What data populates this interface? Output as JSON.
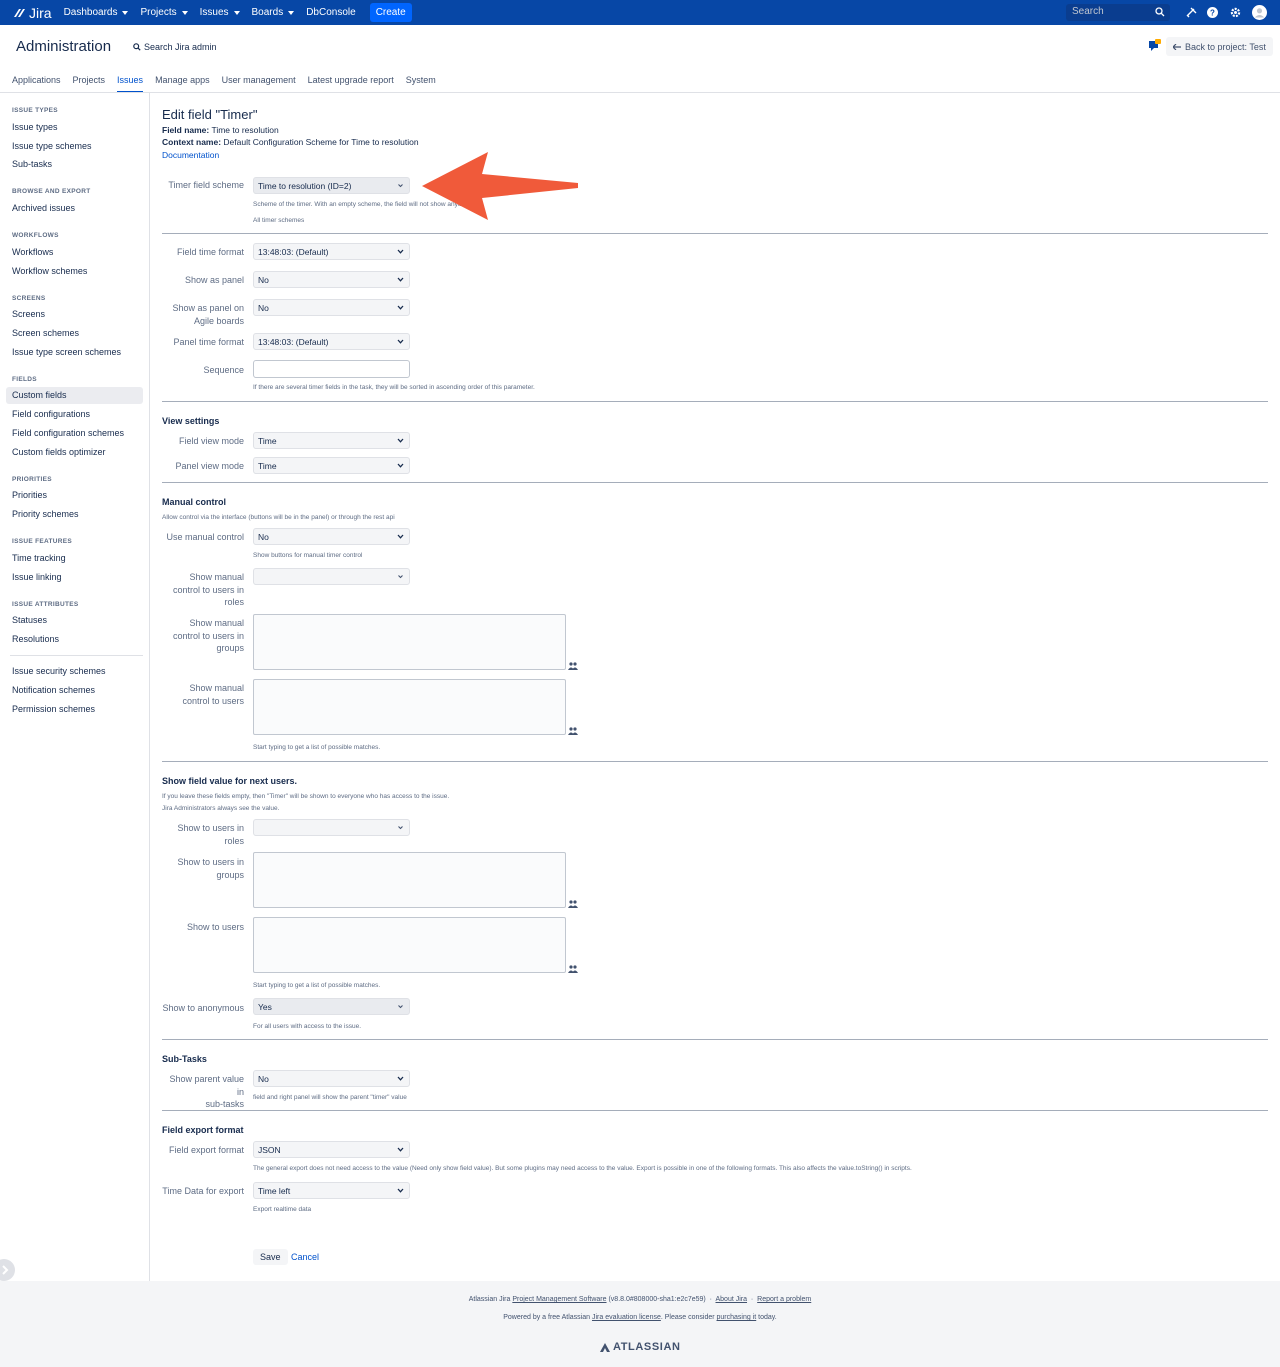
{
  "topnav": {
    "logo": "Jira",
    "items": [
      "Dashboards",
      "Projects",
      "Issues",
      "Boards",
      "DbConsole"
    ],
    "create": "Create",
    "search_placeholder": "Search"
  },
  "header": {
    "title": "Administration",
    "search": "Search Jira admin",
    "back": "Back to project: Test",
    "tabs": [
      "Applications",
      "Projects",
      "Issues",
      "Manage apps",
      "User management",
      "Latest upgrade report",
      "System"
    ],
    "active_tab": "Issues"
  },
  "sidebar": {
    "groups": [
      {
        "title": "ISSUE TYPES",
        "items": [
          "Issue types",
          "Issue type schemes",
          "Sub-tasks"
        ]
      },
      {
        "title": "BROWSE AND EXPORT",
        "items": [
          "Archived issues"
        ]
      },
      {
        "title": "WORKFLOWS",
        "items": [
          "Workflows",
          "Workflow schemes"
        ]
      },
      {
        "title": "SCREENS",
        "items": [
          "Screens",
          "Screen schemes",
          "Issue type screen schemes"
        ]
      },
      {
        "title": "FIELDS",
        "items": [
          "Custom fields",
          "Field configurations",
          "Field configuration schemes",
          "Custom fields optimizer"
        ]
      },
      {
        "title": "PRIORITIES",
        "items": [
          "Priorities",
          "Priority schemes"
        ]
      },
      {
        "title": "ISSUE FEATURES",
        "items": [
          "Time tracking",
          "Issue linking"
        ]
      },
      {
        "title": "ISSUE ATTRIBUTES",
        "items": [
          "Statuses",
          "Resolutions"
        ]
      }
    ],
    "extra": [
      "Issue security schemes",
      "Notification schemes",
      "Permission schemes"
    ],
    "active": "Custom fields"
  },
  "form": {
    "title": "Edit field \"Timer\"",
    "field_name_label": "Field name:",
    "field_name": "Time to resolution",
    "context_label": "Context name:",
    "context": "Default Configuration Scheme for Time to resolution",
    "documentation": "Documentation",
    "timer_scheme_label": "Timer field scheme",
    "timer_scheme_value": "Time to resolution (ID=2)",
    "timer_scheme_help": "Scheme of the timer. With an empty scheme, the field will not show anything.",
    "all_timer_schemes": "All timer schemes",
    "field_time_format_label": "Field time format",
    "field_time_format_value": "13:48:03: (Default)",
    "show_as_panel_label": "Show as panel",
    "show_as_panel_value": "No",
    "show_panel_agile_label_1": "Show as panel on",
    "show_panel_agile_label_2": "Agile boards",
    "show_panel_agile_value": "No",
    "panel_time_format_label": "Panel time format",
    "panel_time_format_value": "13:48:03: (Default)",
    "sequence_label": "Sequence",
    "sequence_help": "If there are several timer fields in the task, they will be sorted in ascending order of this parameter.",
    "view_settings": "View settings",
    "field_view_mode_label": "Field view mode",
    "field_view_mode_value": "Time",
    "panel_view_mode_label": "Panel view mode",
    "panel_view_mode_value": "Time",
    "manual_control": "Manual control",
    "manual_control_help": "Allow control via the interface (buttons will be in the panel) or through the rest api",
    "use_manual_label": "Use manual control",
    "use_manual_value": "No",
    "use_manual_help": "Show buttons for manual timer control",
    "manual_roles_label": [
      "Show manual",
      "control to users in",
      "roles"
    ],
    "manual_groups_label": [
      "Show manual",
      "control to users in",
      "groups"
    ],
    "manual_users_label": [
      "Show manual",
      "control to users"
    ],
    "typing_help": "Start typing to get a list of possible matches.",
    "show_value_title": "Show field value for next users.",
    "show_value_help_1": "If you leave these fields empty, then \"Timer\" will be shown to everyone who has access to the issue.",
    "show_value_help_2": "Jira Administrators always see the value.",
    "show_roles_label": [
      "Show to users in",
      "roles"
    ],
    "show_groups_label": [
      "Show to users in",
      "groups"
    ],
    "show_users_label": "Show to users",
    "show_anon_label": "Show to anonymous",
    "show_anon_value": "Yes",
    "show_anon_help": "For all users with access to the issue.",
    "subtasks": "Sub-Tasks",
    "parent_value_label": [
      "Show parent value in",
      "sub-tasks"
    ],
    "parent_value_value": "No",
    "parent_value_help": "field and right panel will show the parent \"timer\" value",
    "export_title": "Field export format",
    "export_format_label": "Field export format",
    "export_format_value": "JSON",
    "export_format_help": "The general export does not need access to the value (Need only show field value). But some plugins may need access to the value. Export is possible in one of the following formats. This also affects the value.toString() in scripts.",
    "time_data_label": "Time Data for export",
    "time_data_value": "Time left",
    "time_data_help": "Export realtime data",
    "save": "Save",
    "cancel": "Cancel"
  },
  "footer": {
    "line1_a": "Atlassian Jira",
    "line1_link": "Project Management Software",
    "line1_b": "(v8.8.0#808000-sha1:e2c7e59)",
    "about": "About Jira",
    "report": "Report a problem",
    "line2_a": "Powered by a free Atlassian",
    "line2_link": "Jira evaluation license",
    "line2_b": ". Please consider",
    "line2_link2": "purchasing it",
    "line2_c": "today.",
    "brand": "ATLASSIAN"
  },
  "colors": {
    "nav": "#0747a6",
    "accent": "#0052cc",
    "arrow": "#f05a3a"
  }
}
